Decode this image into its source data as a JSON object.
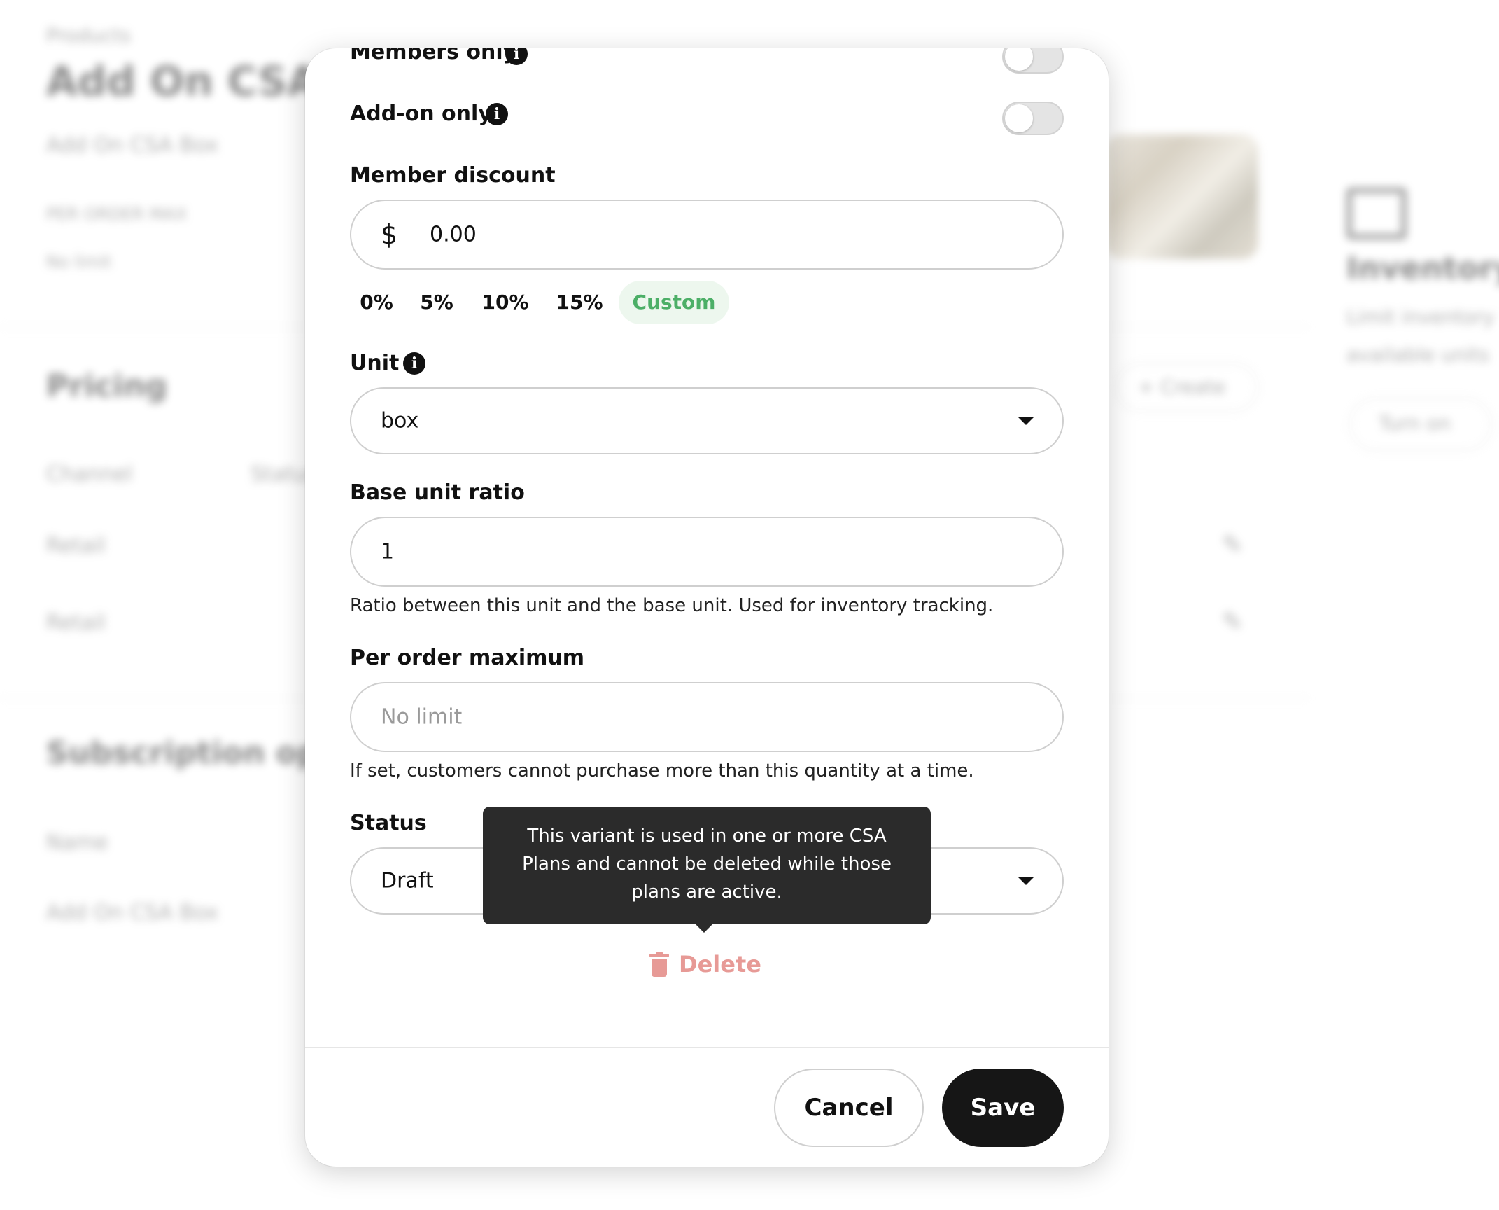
{
  "background": {
    "breadcrumb": "Products",
    "title": "Add On CSA Box",
    "subtitle": "Add On CSA Box",
    "meta_1": "PER ORDER MAX",
    "meta_2": "No limit",
    "pricing_heading": "Pricing",
    "create_label": "+ Create",
    "col_channel": "Channel",
    "col_status": "Status",
    "row_1": "Retail",
    "row_2": "Retail",
    "subscription_heading": "Subscription options",
    "name_label": "Name",
    "name_value": "Add On CSA Box",
    "inventory_heading": "Inventory",
    "inventory_line_1": "Limit inventory",
    "inventory_line_2": "available units",
    "turn_on_label": "Turn on"
  },
  "form": {
    "members_only": {
      "label": "Members only",
      "enabled": false
    },
    "addon_only": {
      "label": "Add-on only",
      "enabled": false
    },
    "member_discount": {
      "label": "Member discount",
      "currency_symbol": "$",
      "value": "0.00",
      "presets": [
        "0%",
        "5%",
        "10%",
        "15%",
        "Custom"
      ],
      "selected_preset": "Custom"
    },
    "unit": {
      "label": "Unit",
      "value": "box"
    },
    "base_unit_ratio": {
      "label": "Base unit ratio",
      "value": "1",
      "help": "Ratio between this unit and the base unit. Used for inventory tracking."
    },
    "per_order_max": {
      "label": "Per order maximum",
      "placeholder": "No limit",
      "help": "If set, customers cannot purchase more than this quantity at a time."
    },
    "status": {
      "label": "Status",
      "value": "Draft"
    }
  },
  "tooltip": {
    "text": "This variant is used in one or more CSA Plans and cannot be deleted while those plans are active."
  },
  "delete_label": "Delete",
  "footer": {
    "cancel_label": "Cancel",
    "save_label": "Save"
  },
  "colors": {
    "accent_green": "#4caf67",
    "delete_red": "#e79a96",
    "primary_button": "#161616",
    "tooltip_bg": "#2b2b2b"
  },
  "icons": [
    "info-icon",
    "dollar-icon",
    "chevron-down-icon",
    "trash-icon",
    "pencil-icon"
  ]
}
